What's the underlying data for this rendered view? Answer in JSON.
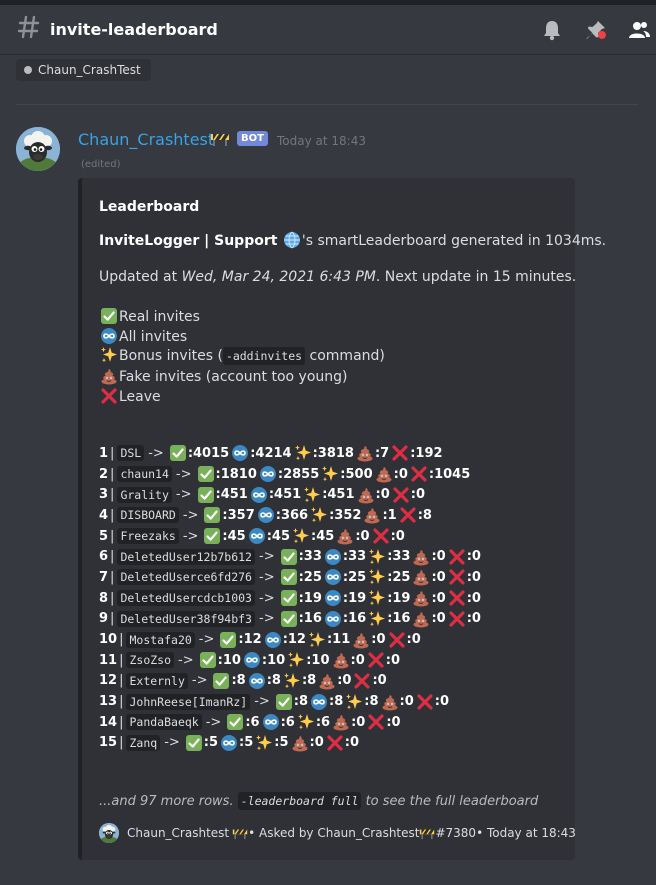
{
  "header": {
    "channel_name": "invite-leaderboard"
  },
  "pill": {
    "label": "Chaun_CrashTest"
  },
  "message": {
    "author": "Chaun_Crashtest",
    "bot_badge": "BOT",
    "timestamp": "Today at 18:43",
    "edited": "(edited)"
  },
  "embed": {
    "title": "Leaderboard",
    "server_name": "InviteLogger | Support",
    "generated_text": "'s smartLeaderboard generated in 1034ms.",
    "updated_prefix": "Updated at ",
    "updated_date": "Wed, Mar 24, 2021 6:43 PM",
    "updated_suffix": ". Next update in 15 minutes.",
    "legend": {
      "real": "Real invites",
      "all": "All invites",
      "bonus_prefix": "Bonus invites (",
      "bonus_cmd": "-addinvites",
      "bonus_suffix": " command)",
      "fake": "Fake invites (account too young)",
      "leave": "Leave"
    },
    "more_prefix": "...and 97 more rows. ",
    "more_cmd": "-leaderboard full",
    "more_suffix": " to see the full leaderboard",
    "footer_author": "Chaun_Crashtest",
    "footer_asked": " • Asked by Chaun_Crashtest ",
    "footer_tag": "#7380",
    "footer_time": " • Today at 18:43"
  },
  "leaderboard": [
    {
      "rank": "1",
      "name": "DSL",
      "real": ":4015",
      "all": ":4214",
      "bonus": ":3818",
      "fake": ":7",
      "leave": ":192"
    },
    {
      "rank": "2",
      "name": "chaun14",
      "real": ":1810",
      "all": ":2855",
      "bonus": ":500",
      "fake": ":0",
      "leave": ":1045"
    },
    {
      "rank": "3",
      "name": "Grality",
      "real": ":451",
      "all": ":451",
      "bonus": ":451",
      "fake": ":0",
      "leave": ":0"
    },
    {
      "rank": "4",
      "name": "DISBOARD",
      "real": ":357",
      "all": ":366",
      "bonus": ":352",
      "fake": ":1",
      "leave": ":8"
    },
    {
      "rank": "5",
      "name": "Freezaks",
      "real": ":45",
      "all": ":45",
      "bonus": ":45",
      "fake": ":0",
      "leave": ":0"
    },
    {
      "rank": "6",
      "name": "DeletedUser12b7b612",
      "real": ":33",
      "all": ":33",
      "bonus": ":33",
      "fake": ":0",
      "leave": ":0"
    },
    {
      "rank": "7",
      "name": "DeletedUserce6fd276",
      "real": ":25",
      "all": ":25",
      "bonus": ":25",
      "fake": ":0",
      "leave": ":0"
    },
    {
      "rank": "8",
      "name": "DeletedUsercdcb1003",
      "real": ":19",
      "all": ":19",
      "bonus": ":19",
      "fake": ":0",
      "leave": ":0"
    },
    {
      "rank": "9",
      "name": "DeletedUser38f94bf3",
      "real": ":16",
      "all": ":16",
      "bonus": ":16",
      "fake": ":0",
      "leave": ":0"
    },
    {
      "rank": "10",
      "name": "Mostafa20",
      "real": ":12",
      "all": ":12",
      "bonus": ":11",
      "fake": ":0",
      "leave": ":0"
    },
    {
      "rank": "11",
      "name": "ZsoZso",
      "real": ":10",
      "all": ":10",
      "bonus": ":10",
      "fake": ":0",
      "leave": ":0"
    },
    {
      "rank": "12",
      "name": "Externly",
      "real": ":8",
      "all": ":8",
      "bonus": ":8",
      "fake": ":0",
      "leave": ":0"
    },
    {
      "rank": "13",
      "name": "JohnReese[ImanRz]",
      "real": ":8",
      "all": ":8",
      "bonus": ":8",
      "fake": ":0",
      "leave": ":0"
    },
    {
      "rank": "14",
      "name": "PandaBaeqk",
      "real": ":6",
      "all": ":6",
      "bonus": ":6",
      "fake": ":0",
      "leave": ":0"
    },
    {
      "rank": "15",
      "name": "Zanq",
      "real": ":5",
      "all": ":5",
      "bonus": ":5",
      "fake": ":0",
      "leave": ":0"
    }
  ],
  "icons": {
    "real": "check-mark-icon",
    "all": "infinity-icon",
    "bonus": "sparkles-icon",
    "fake": "poop-icon",
    "leave": "cross-mark-icon"
  },
  "colors": {
    "background": "#36393f",
    "embed_bg": "#2f3136",
    "username": "#3aa3e3",
    "bot_badge": "#7289da"
  }
}
